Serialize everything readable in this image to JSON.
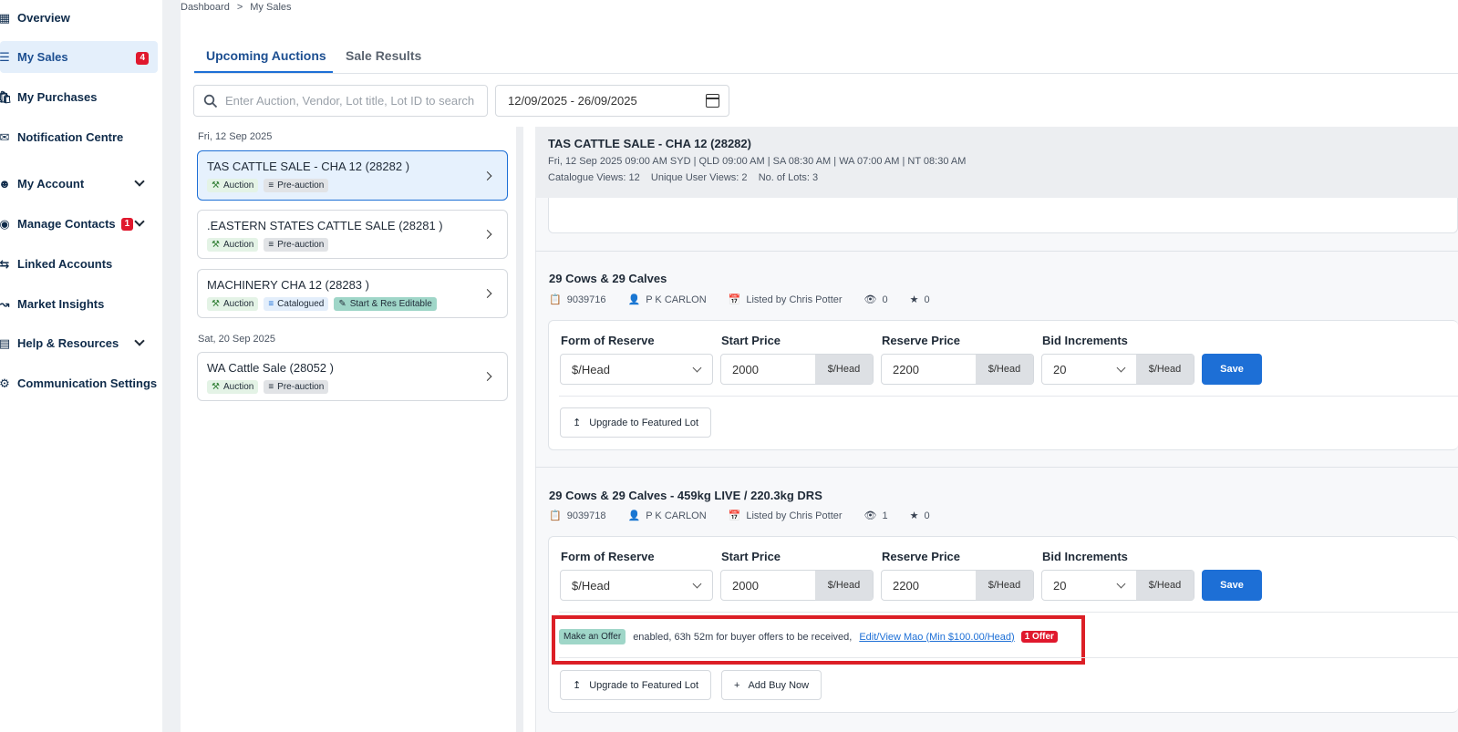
{
  "sidebar": {
    "items": [
      {
        "label": "Overview",
        "icon": "grid-icon"
      },
      {
        "label": "My Sales",
        "icon": "list-icon",
        "badge": "4"
      },
      {
        "label": "My Purchases",
        "icon": "bag-icon"
      },
      {
        "label": "Notification Centre",
        "icon": "bell-icon"
      },
      {
        "label": "My Account",
        "icon": "user-icon"
      },
      {
        "label": "Manage Contacts",
        "icon": "contacts-icon",
        "badge": "1"
      },
      {
        "label": "Linked Accounts",
        "icon": "link-icon"
      },
      {
        "label": "Market Insights",
        "icon": "trend-icon"
      },
      {
        "label": "Help & Resources",
        "icon": "book-icon"
      },
      {
        "label": "Communication Settings",
        "icon": "gear-icon"
      }
    ]
  },
  "breadcrumb": {
    "root": "Dashboard",
    "sep": ">",
    "current": "My Sales"
  },
  "tabs": {
    "upcoming": "Upcoming Auctions",
    "results": "Sale Results"
  },
  "search": {
    "placeholder": "Enter Auction, Vendor, Lot title, Lot ID to search"
  },
  "date_range": "12/09/2025 - 26/09/2025",
  "auctions": {
    "date1": "Fri, 12 Sep 2025",
    "date2": "Sat, 20 Sep 2025",
    "list": [
      {
        "title": "TAS CATTLE SALE - CHA 12 (28282 )",
        "tag1": "Auction",
        "tag2": "Pre-auction"
      },
      {
        "title": ".EASTERN STATES CATTLE SALE (28281 )",
        "tag1": "Auction",
        "tag2": "Pre-auction"
      },
      {
        "title": "MACHINERY CHA 12 (28283 )",
        "tag1": "Auction",
        "tag2": "Catalogued",
        "tag3": "Start & Res Editable"
      },
      {
        "title": "WA Cattle Sale (28052 )",
        "tag1": "Auction",
        "tag2": "Pre-auction"
      }
    ]
  },
  "detail": {
    "title": "TAS CATTLE SALE - CHA 12 (28282)",
    "times": "Fri, 12 Sep 2025 09:00 AM SYD | QLD 09:00 AM | SA 08:30 AM | WA 07:00 AM | NT 08:30 AM",
    "stats": "Catalogue Views: 12    Unique User Views: 2    No. of Lots: 3"
  },
  "fields": {
    "form_of_reserve": "Form of Reserve",
    "start_price": "Start Price",
    "reserve_price": "Reserve Price",
    "bid_increments": "Bid Increments",
    "unit": "$/Head",
    "save": "Save",
    "upgrade": "Upgrade to Featured Lot",
    "buy_now": "Add Buy Now"
  },
  "lots": [
    {
      "title": "29 Cows & 29 Calves",
      "id": "9039716",
      "vendor": "P K CARLON",
      "listed_by": "Listed by Chris Potter",
      "views": "0",
      "stars": "0",
      "reserve_form": "$/Head",
      "start": "2000",
      "reserve": "2200",
      "increment": "20"
    },
    {
      "title": "29 Cows & 29 Calves - 459kg LIVE / 220.3kg DRS",
      "id": "9039718",
      "vendor": "P K CARLON",
      "listed_by": "Listed by Chris Potter",
      "views": "1",
      "stars": "0",
      "reserve_form": "$/Head",
      "start": "2000",
      "reserve": "2200",
      "increment": "20",
      "offer": {
        "tag": "Make an Offer",
        "text": "enabled, 63h 52m for buyer offers to be received,",
        "link": "Edit/View Mao (Min $100.00/Head)",
        "badge": "1 Offer"
      }
    }
  ]
}
